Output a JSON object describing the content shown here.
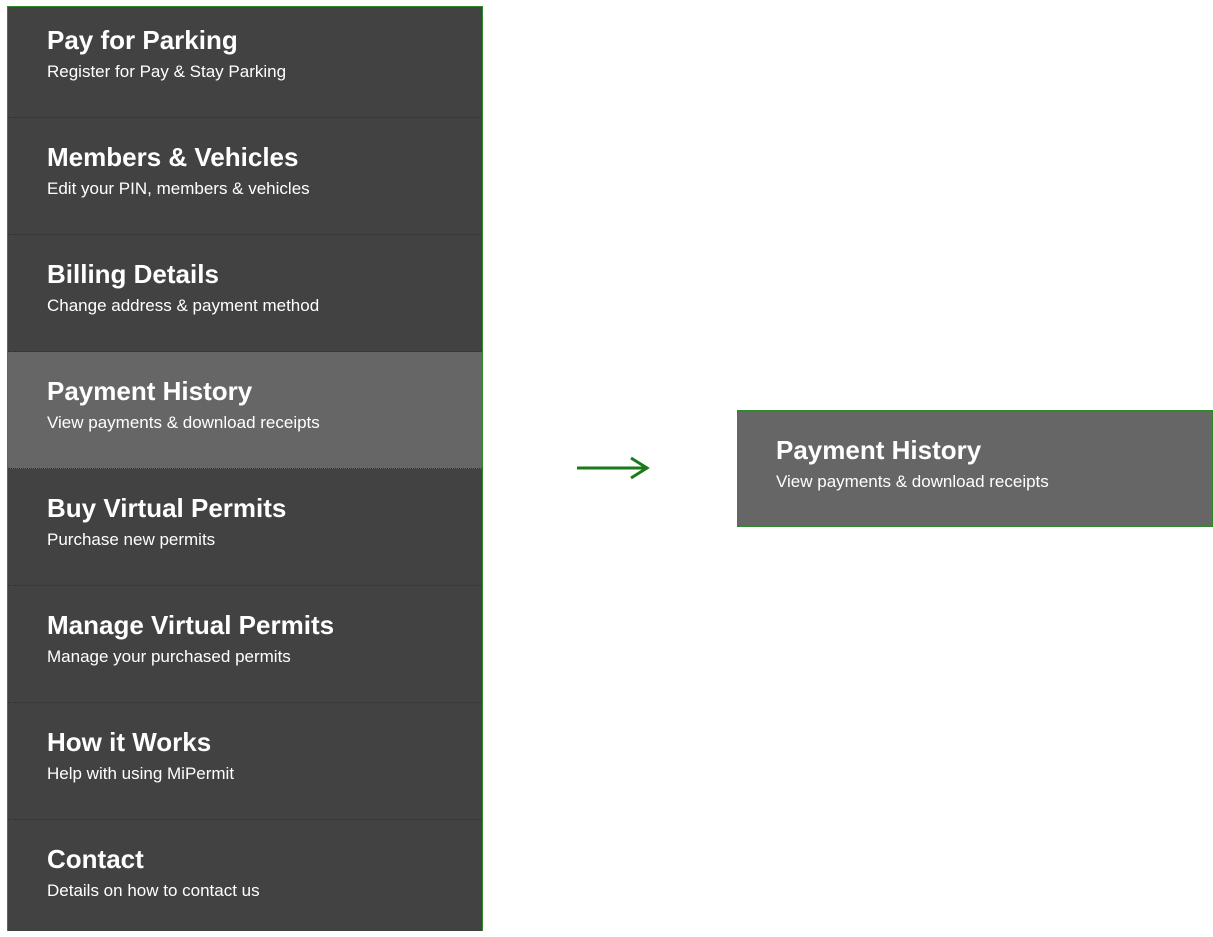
{
  "menu": {
    "items": [
      {
        "title": "Pay for Parking",
        "subtitle": "Register for Pay & Stay Parking"
      },
      {
        "title": "Members & Vehicles",
        "subtitle": "Edit your PIN, members & vehicles"
      },
      {
        "title": "Billing Details",
        "subtitle": "Change address & payment method"
      },
      {
        "title": "Payment History",
        "subtitle": "View payments & download receipts"
      },
      {
        "title": "Buy Virtual Permits",
        "subtitle": "Purchase new permits"
      },
      {
        "title": "Manage Virtual Permits",
        "subtitle": "Manage your purchased permits"
      },
      {
        "title": "How it Works",
        "subtitle": "Help with using MiPermit"
      },
      {
        "title": "Contact",
        "subtitle": "Details on how to contact us"
      }
    ],
    "active_index": 3
  },
  "callout": {
    "title": "Payment History",
    "subtitle": "View payments & download receipts"
  },
  "colors": {
    "menu_bg": "#424242",
    "active_bg": "#666666",
    "border_green": "#2a8a2a",
    "arrow_green": "#1a7a1a",
    "text": "#ffffff"
  },
  "icons": {
    "arrow": "arrow-right-icon"
  }
}
